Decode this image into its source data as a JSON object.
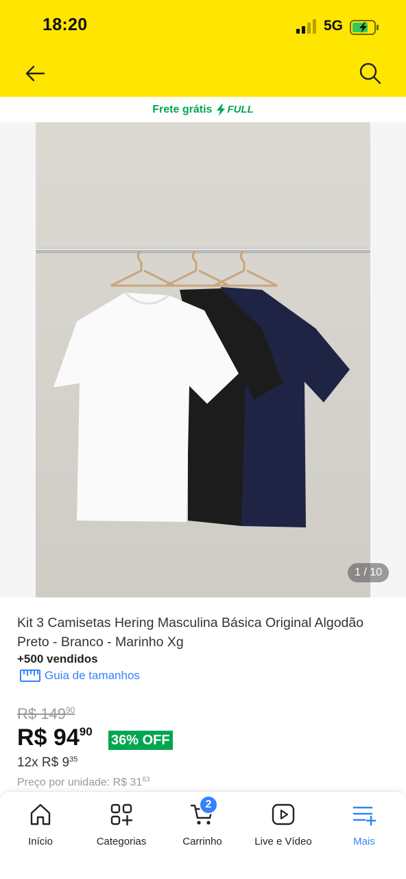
{
  "status_bar": {
    "time": "18:20",
    "network": "5G"
  },
  "header": {
    "back_icon": "arrow-left-icon",
    "search_icon": "search-icon"
  },
  "shipping_banner": {
    "text": "Frete grátis",
    "badge": "FULL",
    "color": "#00a650"
  },
  "gallery": {
    "counter": "1 / 10"
  },
  "product": {
    "title": "Kit 3 Camisetas Hering Masculina Básica Original Algodão Preto - Branco - Marinho Xg",
    "sold": "+500 vendidos",
    "size_guide": "Guia de tamanhos",
    "old_price_main": "R$ 149",
    "old_price_cents": "90",
    "price_main": "R$ 94",
    "price_cents": "90",
    "discount": "36% OFF",
    "installments_main": "12x R$ 9",
    "installments_cents": "35",
    "unit_price_main": "Preço por unidade: R$ 31",
    "unit_price_cents": "63"
  },
  "bottom_nav": {
    "items": [
      {
        "label": "Início",
        "icon": "home-icon"
      },
      {
        "label": "Categorias",
        "icon": "categories-icon"
      },
      {
        "label": "Carrinho",
        "icon": "cart-icon",
        "badge": "2"
      },
      {
        "label": "Live e Vídeo",
        "icon": "play-icon"
      },
      {
        "label": "Mais",
        "icon": "more-icon",
        "active": true
      }
    ]
  },
  "colors": {
    "header_bg": "#ffe600",
    "accent": "#3483fa",
    "success": "#00a650"
  }
}
